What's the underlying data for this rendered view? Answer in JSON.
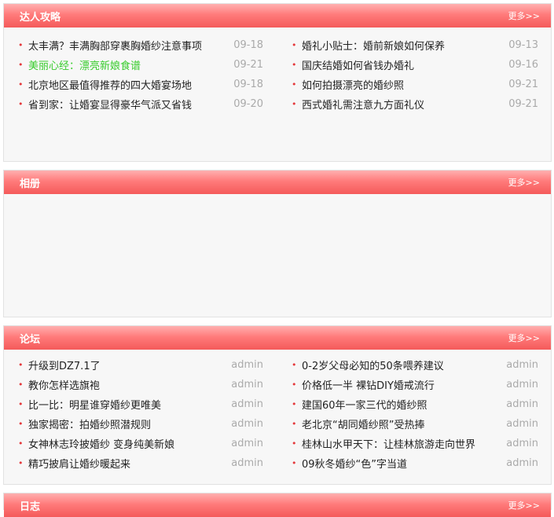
{
  "more_label": "更多>>",
  "expert": {
    "title": "达人攻略",
    "left": [
      {
        "title": "太丰满？丰满胸部穿裹胸婚纱注意事项",
        "date": "09-18"
      },
      {
        "title": "美丽心经：漂亮新娘食谱",
        "date": "09-21"
      },
      {
        "title": "北京地区最值得推荐的四大婚宴场地",
        "date": "09-18"
      },
      {
        "title": "省到家：让婚宴显得豪华气派又省钱",
        "date": "09-20"
      }
    ],
    "right": [
      {
        "title": "婚礼小贴士：婚前新娘如何保养",
        "date": "09-13"
      },
      {
        "title": "国庆结婚如何省钱办婚礼",
        "date": "09-16"
      },
      {
        "title": "如何拍摄漂亮的婚纱照",
        "date": "09-21"
      },
      {
        "title": "西式婚礼需注意九方面礼仪",
        "date": "09-21"
      }
    ]
  },
  "album": {
    "title": "相册"
  },
  "forum": {
    "title": "论坛",
    "left": [
      {
        "title": "升级到DZ7.1了",
        "author": "admin"
      },
      {
        "title": "教你怎样选旗袍",
        "author": "admin"
      },
      {
        "title": "比一比：明星谁穿婚纱更唯美",
        "author": "admin"
      },
      {
        "title": "独家揭密：拍婚纱照潜规则",
        "author": "admin"
      },
      {
        "title": "女神林志玲披婚纱 变身纯美新娘",
        "author": "admin"
      },
      {
        "title": "精巧披肩让婚纱暖起来",
        "author": "admin"
      }
    ],
    "right": [
      {
        "title": "0-2岁父母必知的50条喂养建议",
        "author": "admin"
      },
      {
        "title": "价格低一半 裸钻DIY婚戒流行",
        "author": "admin"
      },
      {
        "title": "建国60年一家三代的婚纱照",
        "author": "admin"
      },
      {
        "title": "老北京“胡同婚纱照”受热捧",
        "author": "admin"
      },
      {
        "title": "桂林山水甲天下：让桂林旅游走向世界",
        "author": "admin"
      },
      {
        "title": "09秋冬婚纱“色”字当道",
        "author": "admin"
      }
    ]
  },
  "blog": {
    "title": "日志"
  },
  "colors": {
    "header_red": "#f45a5a",
    "bullet": "#e4393c",
    "highlight_link": "#39cc2e",
    "meta_gray": "#aaaaaa"
  }
}
